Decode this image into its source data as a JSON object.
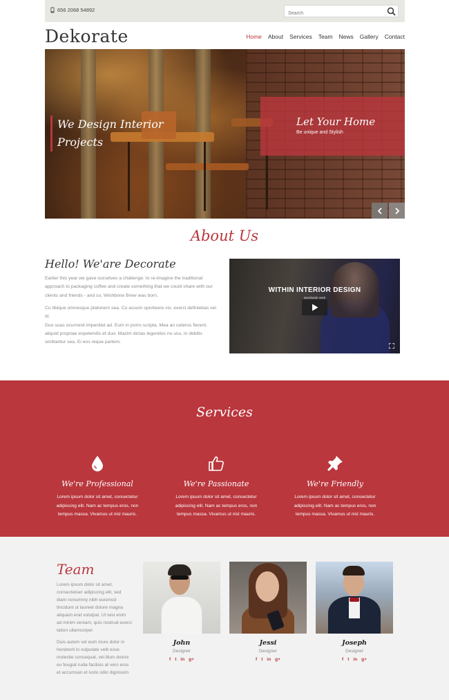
{
  "topbar": {
    "phone": "656 2068 54892",
    "search_placeholder": "Search"
  },
  "header": {
    "logo": "Dekorate",
    "nav": [
      "Home",
      "About",
      "Services",
      "Team",
      "News",
      "Gallery",
      "Contact"
    ],
    "active_nav": "Home"
  },
  "hero": {
    "caption_line1": "We Design Interior",
    "caption_line2": "Projects",
    "box_title": "Let Your Home",
    "box_subtitle": "Be unique and Stylish"
  },
  "about": {
    "title": "About Us",
    "heading": "Hello! We'are Decorate",
    "para1": [
      "Earlier this year we gave ourselves a challenge: to re-imagine the traditional",
      "approach to packaging coffee and create something that we could share with our",
      "clients and friends - and so, Wishbone Brew was born."
    ],
    "para2": [
      "Cu tibique omnesque platonem sea. Cu assum oporteere vix, exerci definiebas vel id.",
      "Duo suas ocurreret imperdiet ad. Eum in porro scripta. Mea an ceteros fierent,",
      "aliquid propriae expetendis et duo. Mazim dictas legendos no usu, in debitis",
      "omittantur sea. Ei eos reque partem."
    ],
    "video_title": "WITHIN INTERIOR DESIGN",
    "video_subtitle": "Worldwide Web"
  },
  "services": {
    "title": "Services",
    "items": [
      {
        "icon": "drop-icon",
        "title": "We're Professional",
        "text": [
          "Lorem ipsum dolor sit amet, consectetur",
          "adipiscing elit. Nam ac tempus eros, non",
          "tempus massa. Vivamus ut nisl mauris."
        ]
      },
      {
        "icon": "thumbs-up-icon",
        "title": "We're Passionate",
        "text": [
          "Lorem ipsum dolor sit amet, consectetur",
          "adipiscing elit. Nam ac tempus eros, non",
          "tempus massa. Vivamus ut nisl mauris."
        ]
      },
      {
        "icon": "pushpin-icon",
        "title": "We're Friendly",
        "text": [
          "Lorem ipsum dolor sit amet, consectetur",
          "adipiscing elit. Nam ac tempus eros, non",
          "tempus massa. Vivamus ut nisl mauris."
        ]
      }
    ]
  },
  "team": {
    "title": "Team",
    "para1": [
      "Lorem ipsum dolor sit amet,",
      "consectetuer adipiscing elit, sed",
      "diam nonummy nibh euismod",
      "tincidunt ut laoreet dolore magna",
      "aliquam erat volutpat. Ut wisi enim",
      "ad minim veniam, quis nostrud exerci",
      "tation ullamcorper"
    ],
    "para2": [
      "Duis autem vel eum iriure dolor in",
      "hendrerit in vulputate velit esse",
      "molestie consequat, vel illum dolore",
      "eu feugiat nulla facilisis at vero eros",
      "et accumsan et iusto odio dignissim"
    ],
    "members": [
      {
        "name": "John",
        "role": "Designer"
      },
      {
        "name": "Jessi",
        "role": "Designer"
      },
      {
        "name": "Joseph",
        "role": "Designer"
      }
    ],
    "social": [
      "f",
      "t",
      "in",
      "g+"
    ]
  },
  "colors": {
    "accent": "#b9373d",
    "topbar": "#e7e8e2",
    "team_bg": "#f2f2f2"
  }
}
